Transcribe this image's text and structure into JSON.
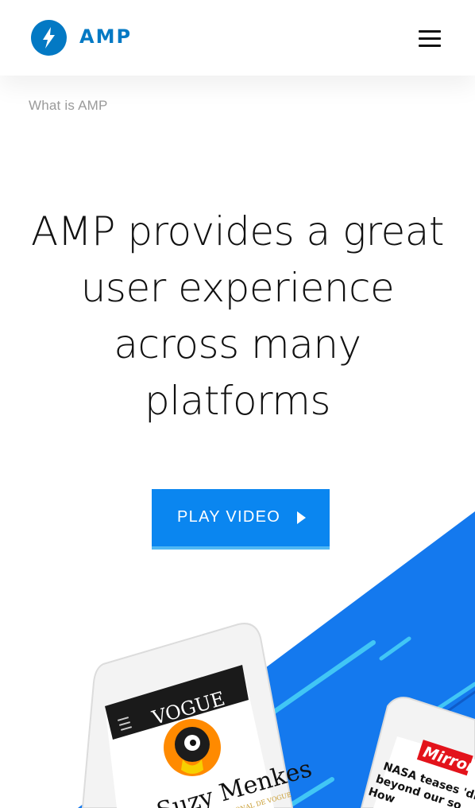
{
  "header": {
    "logo_text": "AMP",
    "brand_color": "#0379c4",
    "menu_icon": "hamburger-menu-icon"
  },
  "breadcrumb": {
    "label": "What is AMP"
  },
  "hero": {
    "lines": [
      "AMP provides a great",
      "user experience",
      "across many",
      "platforms"
    ]
  },
  "cta": {
    "label": "PLAY VIDEO",
    "icon": "play-icon",
    "color": "#0a86f0"
  },
  "illustration": {
    "left_phone": {
      "masthead": "VOGUE",
      "headline": "Suzy Menkes",
      "subhead": "INTERNATIONAL DE VOGUE"
    },
    "right_phone": {
      "masthead": "Mirror",
      "headline_line1": "NASA teases 'discove",
      "headline_line2": "beyond our so",
      "headline_line3": "How"
    },
    "accent_color": "#1479ee"
  }
}
